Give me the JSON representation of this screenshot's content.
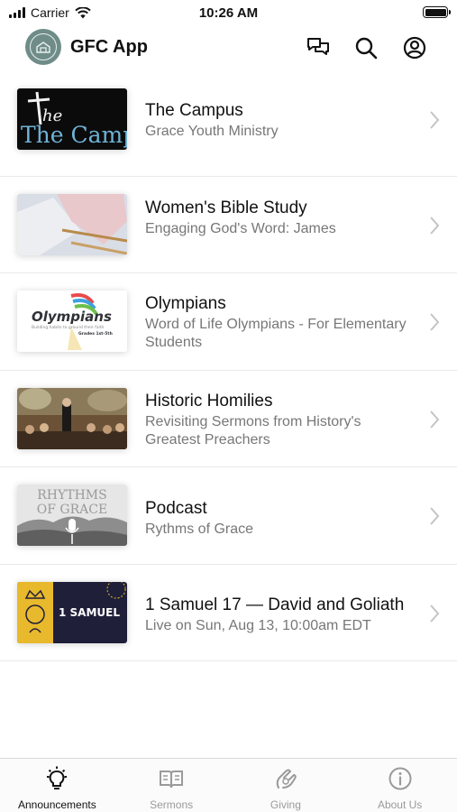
{
  "status_bar": {
    "carrier": "Carrier",
    "time": "10:26 AM"
  },
  "header": {
    "title": "GFC App",
    "icons": [
      "chat-icon",
      "search-icon",
      "profile-icon"
    ]
  },
  "items": [
    {
      "title": "The Campus",
      "subtitle": "Grace Youth Ministry",
      "thumb_text": "The Campus"
    },
    {
      "title": "Women's Bible Study",
      "subtitle": "Engaging God's Word: James",
      "thumb_text": ""
    },
    {
      "title": "Olympians",
      "subtitle": "Word of Life Olympians - For Elementary Students",
      "thumb_text": "Olympians",
      "thumb_tagline": "Building habits to ground their faith",
      "thumb_grades": "Grades 1st-5th"
    },
    {
      "title": "Historic Homilies",
      "subtitle": "Revisiting Sermons from History's Greatest Preachers",
      "thumb_text": ""
    },
    {
      "title": "Podcast",
      "subtitle": "Rythms of Grace",
      "thumb_text": "RHYTHMS OF GRACE"
    },
    {
      "title": "1 Samuel 17 — David and Goliath",
      "subtitle": "Live on Sun, Aug 13, 10:00am EDT",
      "thumb_text": "1 SAMUEL"
    }
  ],
  "tabs": [
    {
      "label": "Announcements",
      "icon": "lightbulb-icon",
      "active": true
    },
    {
      "label": "Sermons",
      "icon": "book-icon",
      "active": false
    },
    {
      "label": "Giving",
      "icon": "giving-icon",
      "active": false
    },
    {
      "label": "About Us",
      "icon": "info-icon",
      "active": false
    }
  ],
  "colors": {
    "accent": "#111111",
    "inactive": "#9a9a9a",
    "divider": "#e9e9e9",
    "logo": "#6f8c89"
  }
}
